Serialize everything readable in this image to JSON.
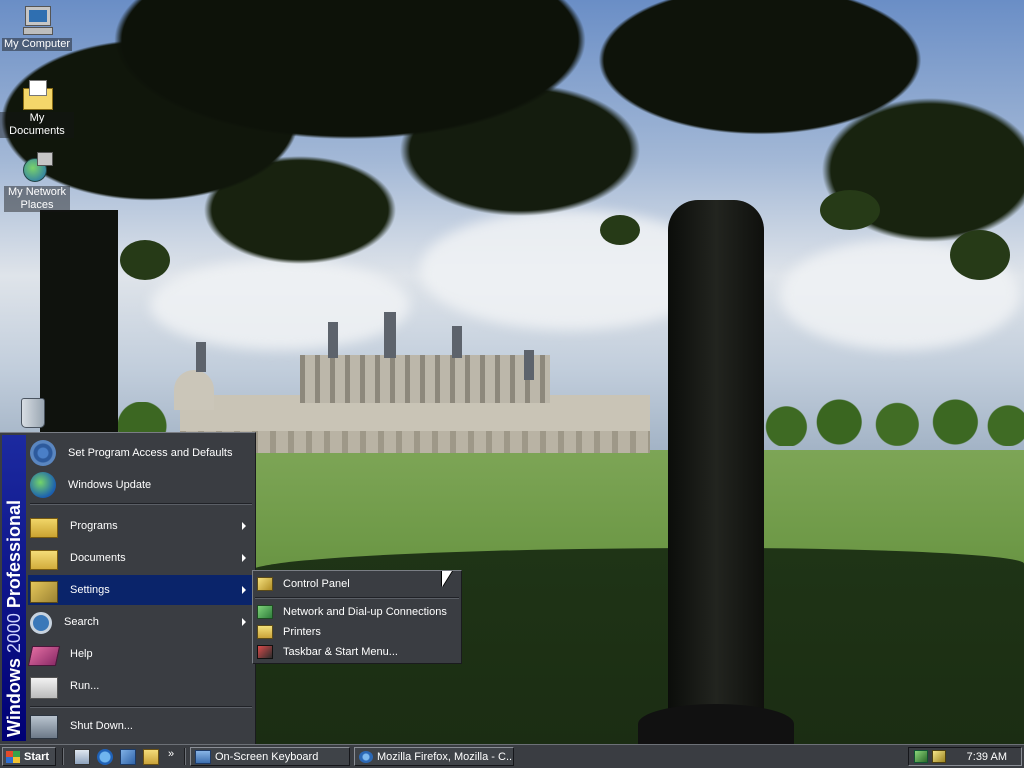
{
  "desktop": {
    "icons": [
      {
        "label": "My Computer",
        "icon": "my-computer-icon"
      },
      {
        "label": "My Documents",
        "icon": "my-documents-icon"
      },
      {
        "label": "My Network Places",
        "icon": "network-places-icon"
      },
      {
        "label": "",
        "icon": "recycle-bin-icon"
      }
    ]
  },
  "start_menu": {
    "banner_bold": "Windows",
    "banner_light": "2000",
    "banner_bold2": "Professional",
    "items": [
      {
        "label": "Set Program Access and Defaults",
        "icon": "program-access-icon",
        "submenu": false
      },
      {
        "label": "Windows Update",
        "icon": "windows-update-icon",
        "submenu": false
      },
      {
        "label": "Programs",
        "icon": "programs-folder-icon",
        "submenu": true
      },
      {
        "label": "Documents",
        "icon": "documents-folder-icon",
        "submenu": true
      },
      {
        "label": "Settings",
        "icon": "settings-icon",
        "submenu": true,
        "highlighted": true
      },
      {
        "label": "Search",
        "icon": "search-icon",
        "submenu": true
      },
      {
        "label": "Help",
        "icon": "help-icon",
        "submenu": false
      },
      {
        "label": "Run...",
        "icon": "run-icon",
        "submenu": false
      },
      {
        "label": "Shut Down...",
        "icon": "shutdown-icon",
        "submenu": false
      }
    ]
  },
  "settings_submenu": {
    "items": [
      {
        "label": "Control Panel",
        "icon": "control-panel-icon"
      },
      {
        "label": "Network and Dial-up Connections",
        "icon": "network-connections-icon"
      },
      {
        "label": "Printers",
        "icon": "printers-icon"
      },
      {
        "label": "Taskbar & Start Menu...",
        "icon": "taskbar-start-menu-icon"
      }
    ]
  },
  "taskbar": {
    "start_label": "Start",
    "quick_launch": [
      "show-desktop-icon",
      "internet-explorer-icon",
      "outlook-express-icon",
      "folder-icon"
    ],
    "quick_launch_more": "»",
    "tasks": [
      {
        "label": "On-Screen Keyboard",
        "icon": "on-screen-keyboard-icon"
      },
      {
        "label": "Mozilla Firefox, Mozilla - C...",
        "icon": "firefox-icon"
      }
    ],
    "tray_icons": [
      "network-tray-icon",
      "volume-tray-icon"
    ],
    "clock": "7:39 AM"
  },
  "colors": {
    "menu_bg": "#3a3d42",
    "highlight": "#0a246a",
    "banner": "#000074"
  }
}
